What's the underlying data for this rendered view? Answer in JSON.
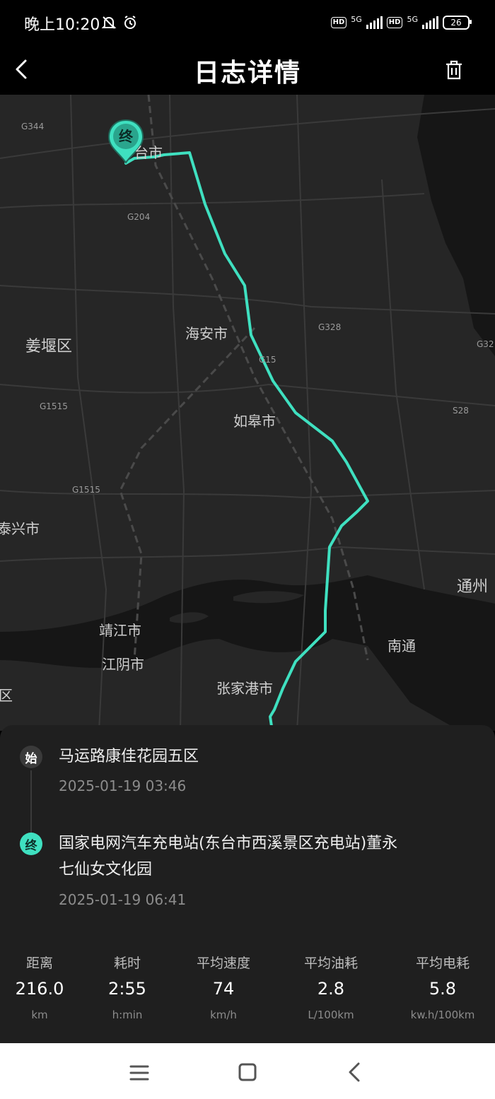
{
  "status_bar": {
    "time": "晚上10:20",
    "network_1": "5G",
    "network_2": "5G",
    "battery": "26",
    "hd_label": "HD"
  },
  "header": {
    "title": "日志详情"
  },
  "map": {
    "marker_label": "终",
    "labels": {
      "dongtai": "台市",
      "haian": "海安市",
      "jiangyan": "姜堰区",
      "rugao": "如皋市",
      "taixing": "泰兴市",
      "tongzhou": "通州",
      "jingjiang": "靖江市",
      "jiangyin": "江阴市",
      "nantong": "南通",
      "zhangjiagang": "张家港市",
      "qu_edge": "区"
    },
    "roads": {
      "g344": "G344",
      "g204": "G204",
      "g328": "G328",
      "g32": "G32",
      "g15": "G15",
      "g1515_a": "G1515",
      "g1515_b": "G1515",
      "s28": "S28"
    },
    "colors": {
      "route": "#3fe0c0",
      "background": "#262626",
      "water": "#161616"
    }
  },
  "trip": {
    "start": {
      "badge": "始",
      "place": "马运路康佳花园五区",
      "datetime": "2025-01-19 03:46"
    },
    "end": {
      "badge": "终",
      "place_line1": "国家电网汽车充电站(东台市西溪景区充电站)董永",
      "place_line2": "七仙女文化园",
      "datetime": "2025-01-19 06:41"
    }
  },
  "stats": [
    {
      "label": "距离",
      "value": "216.0",
      "unit": "km"
    },
    {
      "label": "耗时",
      "value": "2:55",
      "unit": "h:min"
    },
    {
      "label": "平均速度",
      "value": "74",
      "unit": "km/h"
    },
    {
      "label": "平均油耗",
      "value": "2.8",
      "unit": "L/100km"
    },
    {
      "label": "平均电耗",
      "value": "5.8",
      "unit": "kw.h/100km"
    }
  ]
}
